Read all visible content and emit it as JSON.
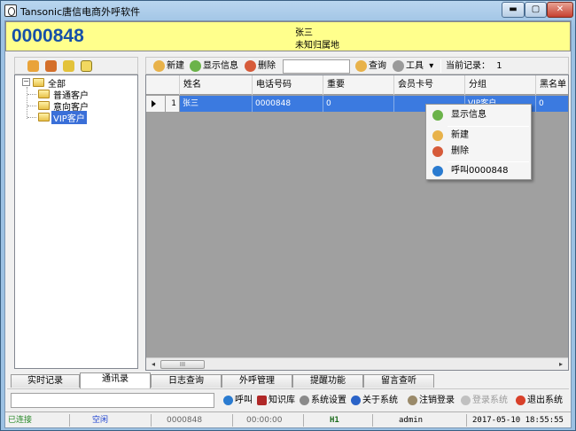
{
  "window": {
    "title": "Tansonic唐信电商外呼软件",
    "min_glyph": "▬",
    "max_glyph": "▢",
    "close_glyph": "✕"
  },
  "caller": {
    "number": "0000848",
    "name": "张三",
    "location": "未知归属地"
  },
  "tree": {
    "root": "全部",
    "expander": "−",
    "items": [
      "普通客户",
      "意向客户",
      "VIP客户"
    ]
  },
  "toolbar": {
    "new_label": "新建",
    "show_info_label": "显示信息",
    "delete_label": "删除",
    "search_value": "",
    "query_label": "查询",
    "tools_label": "工具",
    "tools_arrow": "▾",
    "current_record_label": "当前记录：",
    "current_record_value": "1"
  },
  "grid": {
    "columns": [
      "姓名",
      "电话号码",
      "重要",
      "会员卡号",
      "分组",
      "黑名单"
    ],
    "rows": [
      {
        "num": "1",
        "cells": [
          "张三",
          "0000848",
          "0",
          "",
          "VIP客户",
          "0"
        ]
      }
    ],
    "scroll_left": "◂",
    "scroll_right": "▸",
    "scroll_thumb": "III"
  },
  "context_menu": {
    "items": [
      "显示信息",
      "新建",
      "删除",
      "呼叫0000848"
    ]
  },
  "tabs": [
    "实时记录",
    "通讯录",
    "日志查询",
    "外呼管理",
    "提醒功能",
    "留言查听"
  ],
  "bottom": {
    "input_value": "",
    "call_label": "呼叫",
    "knowledge_label": "知识库",
    "settings_label": "系统设置",
    "about_label": "关于系统",
    "logout_label": "注销登录",
    "login_label": "登录系统",
    "exit_label": "退出系统"
  },
  "status": {
    "connection": "已连接",
    "line_state": "空闲",
    "number": "0000848",
    "duration": "00:00:00",
    "channel": "H1",
    "user": "admin",
    "datetime": "2017-05-10 18:55:55"
  },
  "colors": {
    "caller_bar": "#ffff8c",
    "caller_number": "#1650a8",
    "selection": "#3b7ae0",
    "connected": "#2a8a2a",
    "idle": "#1a3fcf"
  }
}
